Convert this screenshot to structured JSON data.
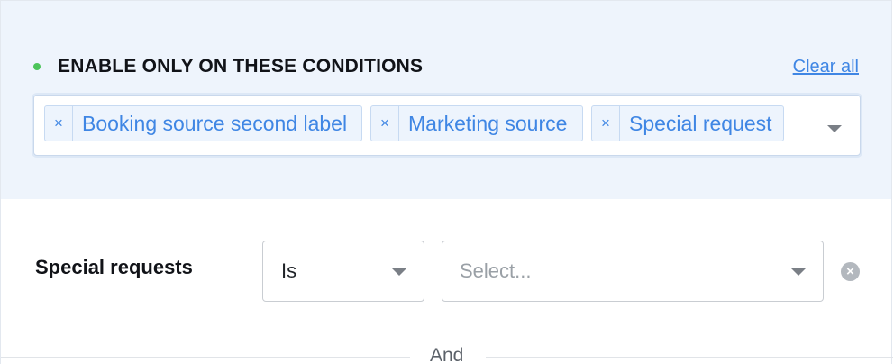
{
  "section": {
    "title": "ENABLE ONLY ON THESE CONDITIONS",
    "clear_all_label": "Clear all",
    "status_color": "#4cc45a"
  },
  "selected_tags": [
    {
      "label": "Booking source second label",
      "remove_glyph": "×"
    },
    {
      "label": "Marketing source",
      "remove_glyph": "×"
    },
    {
      "label": "Special request",
      "remove_glyph": "×"
    }
  ],
  "condition": {
    "label": "Special requests",
    "operator_value": "Is",
    "value_placeholder": "Select...",
    "remove_icon": "x-circle-icon"
  },
  "connector": {
    "label": "And"
  },
  "colors": {
    "accent": "#3f86e4",
    "panel_bg": "#eef4fc"
  }
}
